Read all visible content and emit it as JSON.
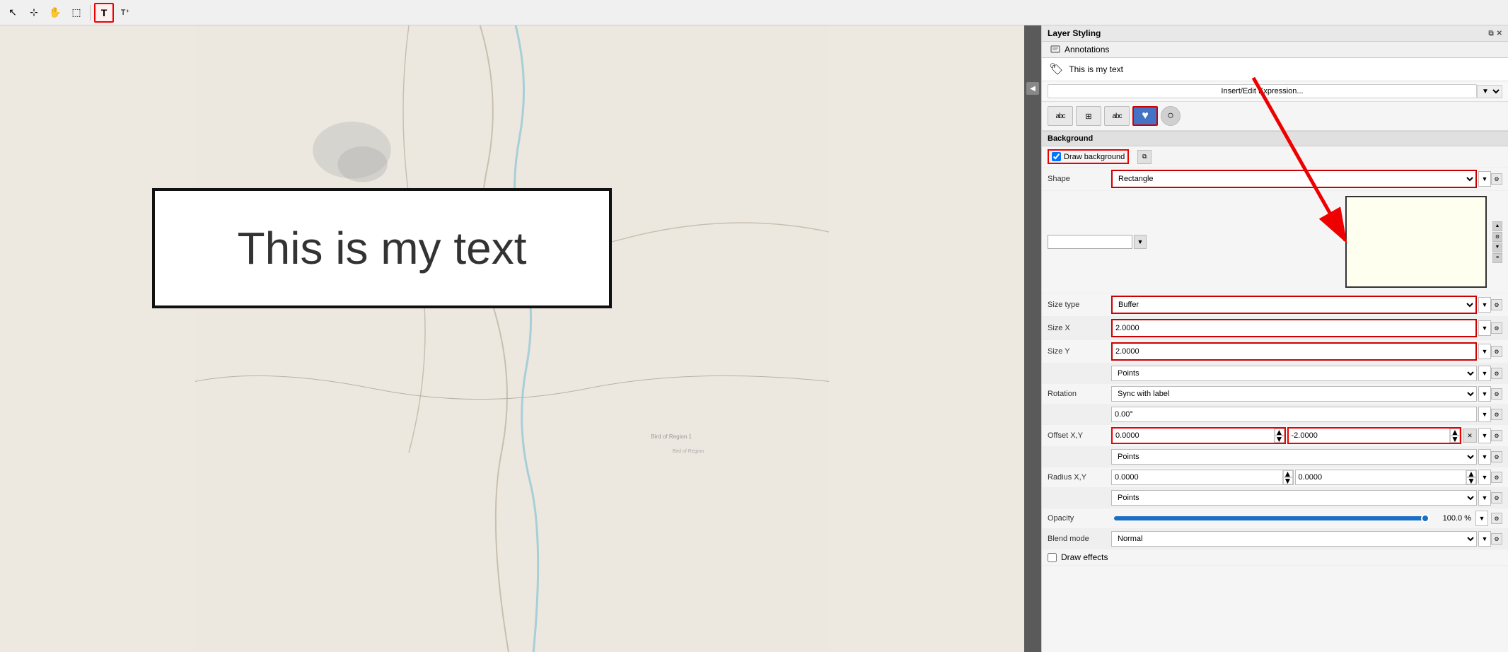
{
  "toolbar": {
    "buttons": [
      {
        "id": "select-arrow",
        "label": "↖",
        "active": false,
        "icon": "↖"
      },
      {
        "id": "select-node",
        "label": "⊹",
        "active": false,
        "icon": "⊹"
      },
      {
        "id": "pan",
        "label": "✋",
        "active": false,
        "icon": "✋"
      },
      {
        "id": "zoom-select",
        "label": "⬚",
        "active": false,
        "icon": "⬚"
      },
      {
        "id": "text-annotation",
        "label": "T",
        "active": true,
        "icon": "T"
      },
      {
        "id": "text-format",
        "label": "T⁺",
        "active": false,
        "icon": "T⁺"
      }
    ]
  },
  "map": {
    "annotation_text": "This is my text"
  },
  "panel": {
    "title": "Layer Styling",
    "tab": "Annotations",
    "layer_name": "This is my text",
    "expression_btn": "Insert/Edit Expression...",
    "icons": [
      {
        "id": "abc-tab",
        "label": "abc"
      },
      {
        "id": "grid-tab",
        "label": "⊞"
      },
      {
        "id": "abc2-tab",
        "label": "abc"
      },
      {
        "id": "heart-tab",
        "label": "♥",
        "active": true
      },
      {
        "id": "circle-tab",
        "label": "○"
      }
    ],
    "background": {
      "section_label": "Background",
      "draw_bg_label": "Draw background",
      "draw_bg_checked": true,
      "shape_label": "Shape",
      "shape_value": "Rectangle",
      "color_value": "",
      "size_type_label": "Size type",
      "size_type_value": "Buffer",
      "size_x_label": "Size X",
      "size_x_value": "2.0000",
      "size_y_label": "Size Y",
      "size_y_value": "2.0000",
      "unit_value": "Points",
      "rotation_label": "Rotation",
      "rotation_value": "Sync with label",
      "rotation_degrees": "0.00°",
      "offset_label": "Offset X,Y",
      "offset_x_value": "0.0000",
      "offset_y_value": "-2.0000",
      "offset_unit": "Points",
      "radius_label": "Radius X,Y",
      "radius_x_value": "0.0000",
      "radius_y_value": "0.0000",
      "radius_unit": "Points",
      "opacity_label": "Opacity",
      "opacity_value": "100.0 %",
      "blend_label": "Blend mode",
      "blend_value": "Normal",
      "effects_label": "Draw effects"
    }
  }
}
